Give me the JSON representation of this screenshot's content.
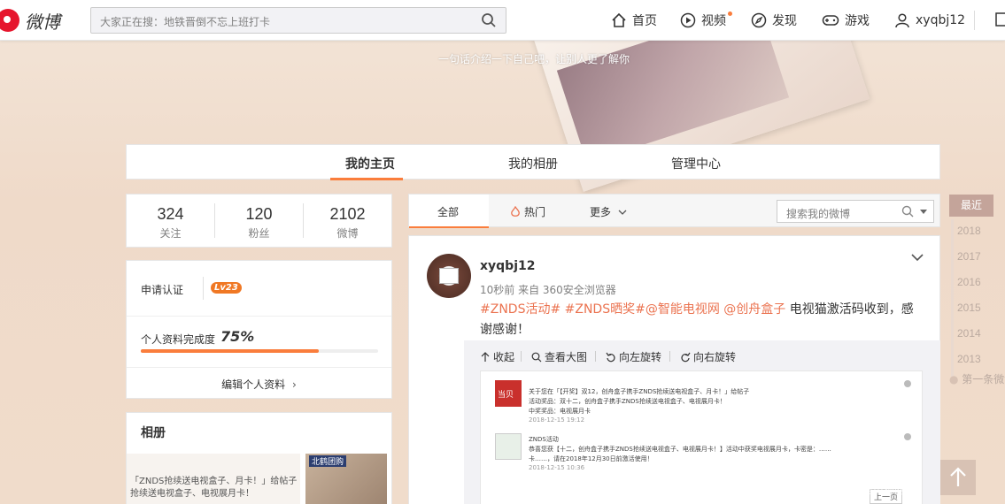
{
  "header": {
    "logo_text": "微博",
    "search_placeholder": "大家正在搜：地铁晋倒不忘上班打卡",
    "nav": [
      {
        "label": "首页",
        "icon": "home-icon"
      },
      {
        "label": "视频",
        "icon": "video-icon"
      },
      {
        "label": "发现",
        "icon": "compass-icon"
      },
      {
        "label": "游戏",
        "icon": "gamepad-icon"
      },
      {
        "label": "xyqbj12",
        "icon": "user-icon"
      }
    ]
  },
  "cover": {
    "intro": "一句话介绍一下自己吧，让别人更了解你"
  },
  "tabs": [
    "我的主页",
    "我的相册",
    "管理中心"
  ],
  "counts": [
    {
      "num": "324",
      "label": "关注"
    },
    {
      "num": "120",
      "label": "粉丝"
    },
    {
      "num": "2102",
      "label": "微博"
    }
  ],
  "profile": {
    "verify": "申请认证",
    "level": "Lv23",
    "complete_label": "个人资料完成度",
    "complete_pct": "75%",
    "complete_value": 0.75,
    "edit": "编辑个人资料"
  },
  "album": {
    "title": "相册",
    "thumb_lines": [
      "「ZNDS抢续送电视盒子、月卡！」给帖子",
      "抢续送电视盒子、电视展月卡！"
    ],
    "thumb_badge": "北鹤团购"
  },
  "filter": {
    "all": "全部",
    "hot": "热门",
    "more": "更多",
    "search_placeholder": "搜索我的微博"
  },
  "post": {
    "name": "xyqbj12",
    "meta": "10秒前 来自 360安全浏览器",
    "tags": "#ZNDS活动# #ZNDS晒奖#@智能电视网 @创舟盒子",
    "text": " 电视猫激活码收到，感谢感谢！",
    "tools": [
      "收起",
      "查看大图",
      "向左旋转",
      "向右旋转"
    ],
    "shot": {
      "row1": [
        "关于您在「【开奖】双12，创舟盒子携手ZNDS抢续送电视盒子、月卡！」给帖子",
        "活动奖品：双十二，创舟盒子携手ZNDS抢续送电视盒子、电视展月卡！",
        "中奖奖品：电视展月卡",
        "2018-12-15 19:12"
      ],
      "row2": [
        "ZNDS活动",
        "恭喜您获【十二，创舟盒子携手ZNDS抢续送电视盒子、电视展月卡！】活动中获奖电视展月卡，卡密是：……",
        "卡……，请在2018年12月30日前激活使用！",
        "2018-12-15 10:36"
      ],
      "next": "上一页"
    }
  },
  "timeline": {
    "recent": "最近",
    "years": [
      "2018",
      "2017",
      "2016",
      "2015",
      "2014",
      "2013"
    ],
    "first": "第一条微博"
  },
  "watermark": "@智能电视网"
}
